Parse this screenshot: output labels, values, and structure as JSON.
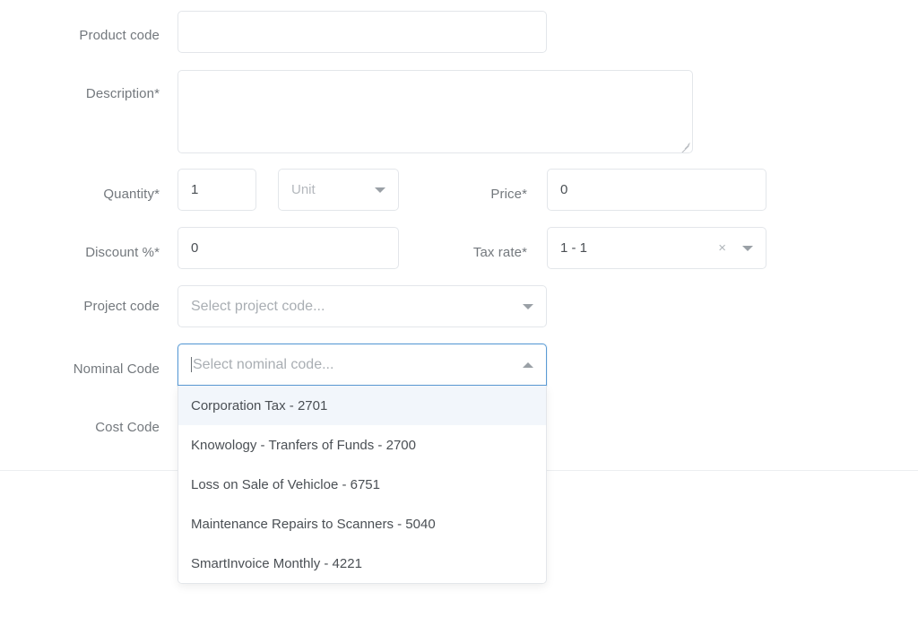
{
  "form": {
    "fields": {
      "product_code": {
        "label": "Product code",
        "value": "",
        "placeholder": ""
      },
      "description": {
        "label": "Description",
        "required_marker": "*",
        "value": "",
        "placeholder": ""
      },
      "quantity": {
        "label": "Quantity",
        "required_marker": "*",
        "value": "1"
      },
      "unit": {
        "placeholder": "Unit",
        "value": "",
        "icon": "chevron-down-icon"
      },
      "price": {
        "label": "Price",
        "required_marker": "*",
        "value": "0"
      },
      "discount": {
        "label": "Discount %",
        "required_marker": "*",
        "value": "0"
      },
      "tax_rate": {
        "label": "Tax rate",
        "required_marker": "*",
        "value": "1 - 1",
        "clear_icon": "close-icon",
        "clear_glyph": "×",
        "dropdown_icon": "chevron-down-icon"
      },
      "project_code": {
        "label": "Project code",
        "value": "",
        "placeholder": "Select project code...",
        "icon": "chevron-down-icon"
      },
      "nominal_code": {
        "label": "Nominal Code",
        "value": "",
        "placeholder": "Select nominal code...",
        "icon": "chevron-up-icon",
        "expanded": true
      },
      "cost_code": {
        "label": "Cost Code",
        "value": ""
      }
    }
  },
  "nominal_code_menu": {
    "options": [
      {
        "label": "Corporation Tax - 2701",
        "highlighted": true
      },
      {
        "label": "Knowology - Tranfers of Funds - 2700",
        "highlighted": false
      },
      {
        "label": "Loss on Sale of Vehicloe - 6751",
        "highlighted": false
      },
      {
        "label": "Maintenance Repairs to Scanners - 5040",
        "highlighted": false
      },
      {
        "label": "SmartInvoice Monthly - 4221",
        "highlighted": false
      }
    ]
  },
  "colors": {
    "accent_focus_border": "#5b9bd5",
    "field_border": "#e3e6ea",
    "label_text": "#73787d",
    "value_text": "#4a4f54",
    "placeholder_text": "#b4b8bd",
    "highlight_row": "#f2f6fb",
    "divider": "#eceef0",
    "page_background": "#ffffff"
  }
}
